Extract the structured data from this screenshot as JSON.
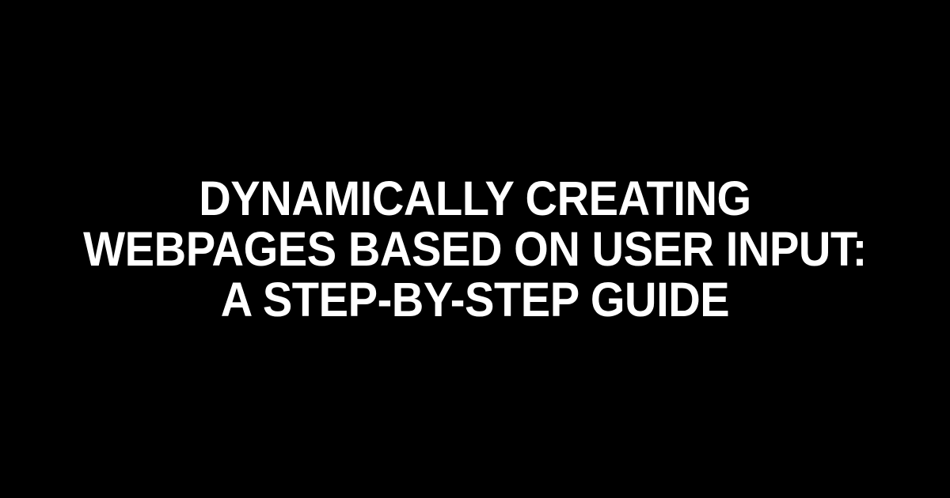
{
  "heading": "Dynamically Creating Webpages Based on User Input: A Step-by-Step Guide"
}
